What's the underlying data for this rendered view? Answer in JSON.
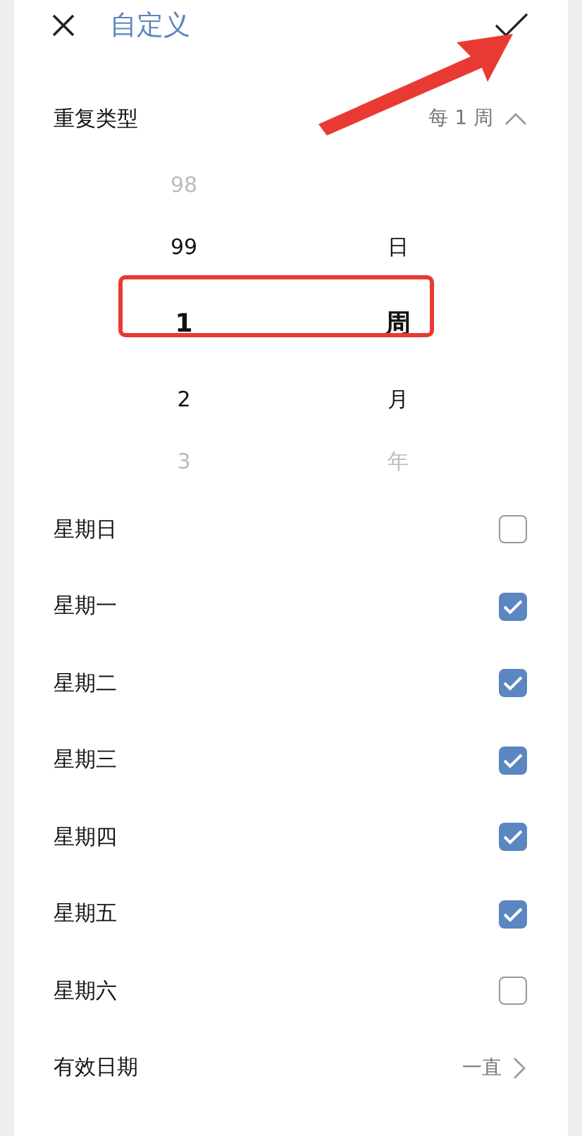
{
  "header": {
    "title": "自定义"
  },
  "repeat": {
    "label": "重复类型",
    "value": "每 1 周",
    "expanded": true
  },
  "picker": {
    "columns": [
      {
        "items": [
          {
            "label": "98",
            "selected": false
          },
          {
            "label": "99",
            "selected": false
          },
          {
            "label": "1",
            "selected": true
          },
          {
            "label": "2",
            "selected": false
          },
          {
            "label": "3",
            "selected": false
          }
        ]
      },
      {
        "items": [
          {
            "label": "日",
            "selected": false
          },
          {
            "label": "周",
            "selected": true
          },
          {
            "label": "月",
            "selected": false
          },
          {
            "label": "年",
            "selected": false
          }
        ]
      }
    ]
  },
  "days": [
    {
      "label": "星期日",
      "checked": false
    },
    {
      "label": "星期一",
      "checked": true
    },
    {
      "label": "星期二",
      "checked": true
    },
    {
      "label": "星期三",
      "checked": true
    },
    {
      "label": "星期四",
      "checked": true
    },
    {
      "label": "星期五",
      "checked": true
    },
    {
      "label": "星期六",
      "checked": false
    }
  ],
  "valid": {
    "label": "有效日期",
    "value": "一直"
  }
}
